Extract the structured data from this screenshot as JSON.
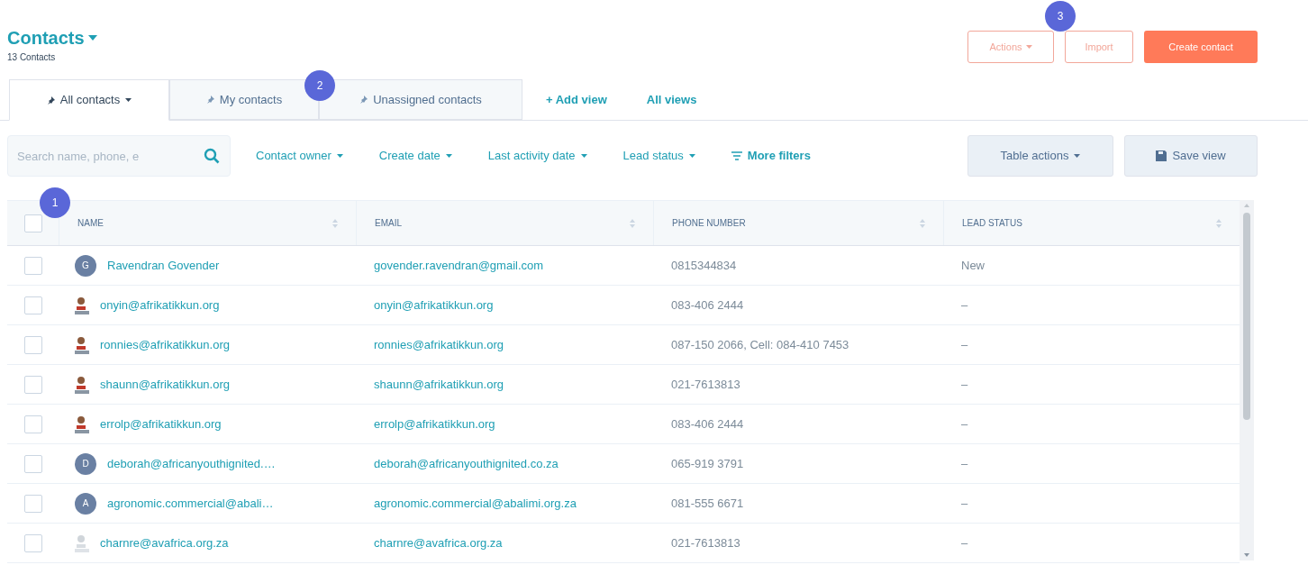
{
  "header": {
    "title": "Contacts",
    "count": "13 Contacts"
  },
  "actions": [
    {
      "label": "Actions",
      "kind": "menu"
    },
    {
      "label": "Import",
      "kind": "outline"
    },
    {
      "label": "Create contact",
      "kind": "primary"
    }
  ],
  "tabs": [
    {
      "label": "All contacts",
      "selected": true,
      "menu": true
    },
    {
      "label": "My contacts",
      "selected": false,
      "menu": false
    },
    {
      "label": "Unassigned contacts",
      "selected": false,
      "menu": false
    }
  ],
  "view_links": [
    "+ Add view",
    "All views"
  ],
  "search": {
    "placeholder": "Search name, phone, e"
  },
  "filters": [
    {
      "label": "Contact owner",
      "kind": "dropdown"
    },
    {
      "label": "Create date",
      "kind": "dropdown"
    },
    {
      "label": "Last activity date",
      "kind": "dropdown"
    },
    {
      "label": "Lead status",
      "kind": "dropdown"
    },
    {
      "label": "More filters",
      "kind": "more"
    }
  ],
  "table_buttons": [
    {
      "label": "Table actions",
      "kind": "menu"
    },
    {
      "label": "Save view",
      "kind": "save"
    }
  ],
  "table": {
    "all_checked": false,
    "columns": [
      "NAME",
      "EMAIL",
      "PHONE NUMBER",
      "LEAD STATUS"
    ],
    "rows": [
      {
        "checked": false,
        "avatar": {
          "kind": "initial",
          "text": "G"
        },
        "name": "Ravendran Govender",
        "email": "govender.ravendran@gmail.com",
        "phone": "0815344834",
        "lead_status": "New"
      },
      {
        "checked": false,
        "avatar": {
          "kind": "person"
        },
        "name": "onyin@afrikatikkun.org",
        "email": "onyin@afrikatikkun.org",
        "phone": "083-406 2444",
        "lead_status": "–"
      },
      {
        "checked": false,
        "avatar": {
          "kind": "person"
        },
        "name": "ronnies@afrikatikkun.org",
        "email": "ronnies@afrikatikkun.org",
        "phone": "087-150 2066, Cell: 084-410 7453",
        "lead_status": "–"
      },
      {
        "checked": false,
        "avatar": {
          "kind": "person"
        },
        "name": "shaunn@afrikatikkun.org",
        "email": "shaunn@afrikatikkun.org",
        "phone": "021-7613813",
        "lead_status": "–"
      },
      {
        "checked": false,
        "avatar": {
          "kind": "person"
        },
        "name": "errolp@afrikatikkun.org",
        "email": "errolp@afrikatikkun.org",
        "phone": "083-406 2444",
        "lead_status": "–"
      },
      {
        "checked": false,
        "avatar": {
          "kind": "initial",
          "text": "D"
        },
        "name": "deborah@africanyouthignited.…",
        "email": "deborah@africanyouthignited.co.za",
        "phone": "065-919 3791",
        "lead_status": "–"
      },
      {
        "checked": false,
        "avatar": {
          "kind": "initial",
          "text": "A"
        },
        "name": "agronomic.commercial@abali…",
        "email": "agronomic.commercial@abalimi.org.za",
        "phone": "081-555 6671",
        "lead_status": "–"
      },
      {
        "checked": false,
        "avatar": {
          "kind": "faded_person"
        },
        "name": "charnre@avafrica.org.za",
        "email": "charnre@avafrica.org.za",
        "phone": "021-7613813",
        "lead_status": "–"
      }
    ]
  },
  "callouts": [
    "1",
    "2",
    "3"
  ]
}
